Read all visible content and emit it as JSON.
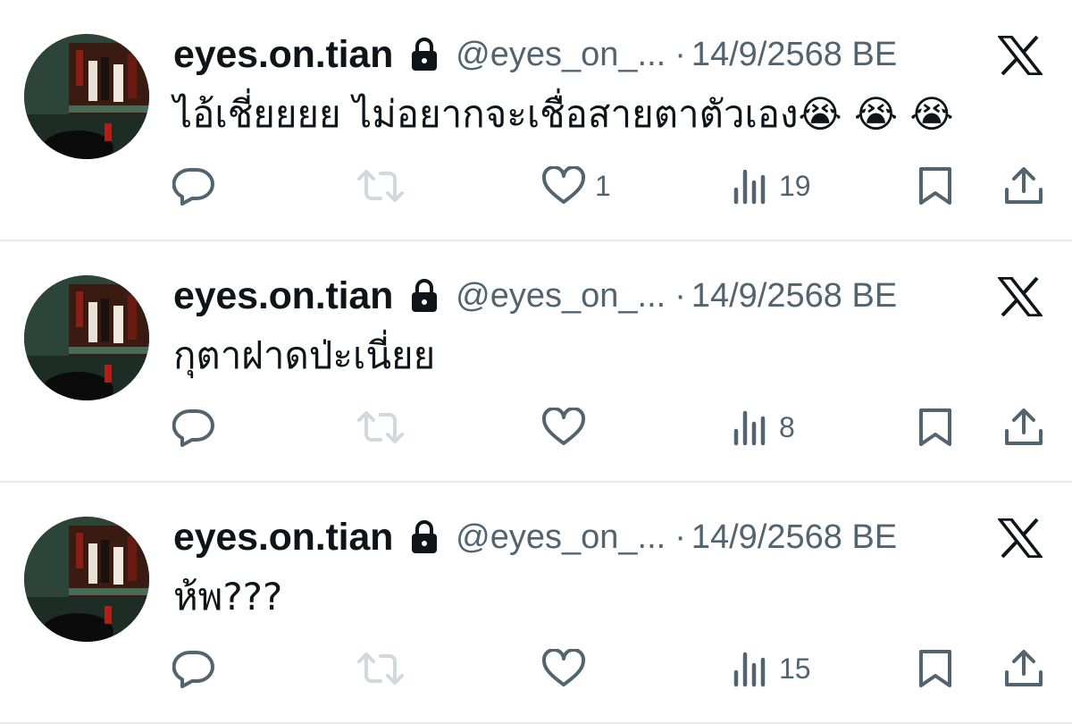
{
  "tweets": [
    {
      "display_name": "eyes.on.tian",
      "handle": "@eyes_on_...",
      "separator": "·",
      "date": "14/9/2568 BE",
      "text": "ไอ้เชี่ยยยย ไม่อยากจะเชื่อสายตาตัวเอง😭 😭 😭",
      "likes": "1",
      "views": "19"
    },
    {
      "display_name": "eyes.on.tian",
      "handle": "@eyes_on_...",
      "separator": "·",
      "date": "14/9/2568 BE",
      "text": "กุตาฝาดป่ะเนี่ยย",
      "likes": "",
      "views": "8"
    },
    {
      "display_name": "eyes.on.tian",
      "handle": "@eyes_on_...",
      "separator": "·",
      "date": "14/9/2568 BE",
      "text": "ห้พ???",
      "likes": "",
      "views": "15"
    }
  ],
  "icons": {
    "brand": "x-logo-icon",
    "lock": "lock-icon",
    "reply": "reply-icon",
    "retweet": "retweet-icon",
    "like": "heart-icon",
    "views": "views-icon",
    "bookmark": "bookmark-icon",
    "share": "share-icon"
  },
  "colors": {
    "text": "#0f1419",
    "secondary": "#536471",
    "retweet_disabled": "#cfd9de",
    "separator": "#e6e8ea"
  }
}
